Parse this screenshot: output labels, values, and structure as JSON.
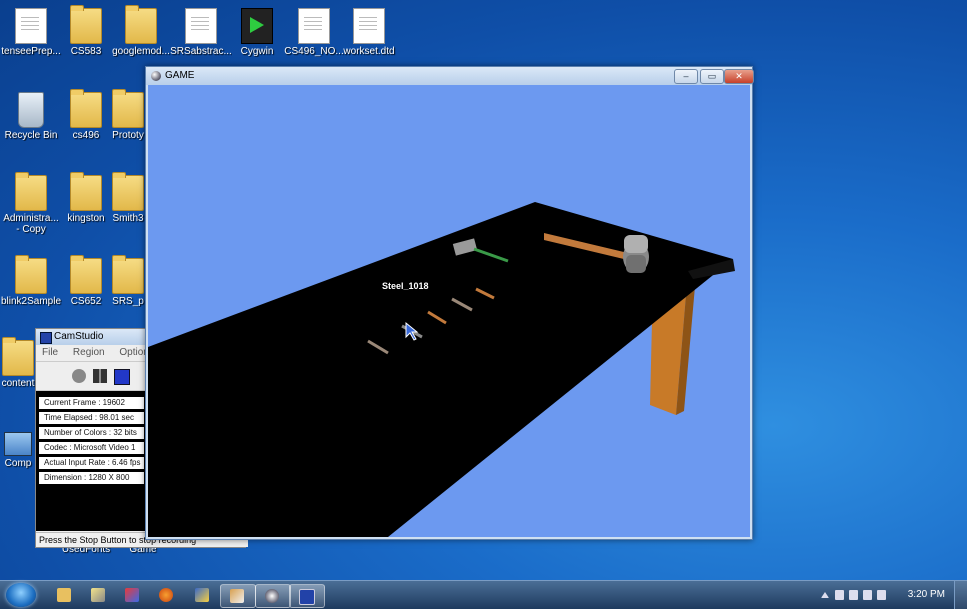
{
  "desktop": {
    "icons": [
      {
        "label": "tenseePrep...",
        "icon": "document-icon"
      },
      {
        "label": "CS583",
        "icon": "folder-icon"
      },
      {
        "label": "googlemod...",
        "icon": "folder-icon"
      },
      {
        "label": "SRSabstrac...",
        "icon": "document-icon"
      },
      {
        "label": "Cygwin",
        "icon": "cygwin-icon"
      },
      {
        "label": "CS496_NO...",
        "icon": "document-icon"
      },
      {
        "label": "workset.dtd",
        "icon": "document-icon"
      },
      {
        "label": "Recycle Bin",
        "icon": "recycle-bin-icon"
      },
      {
        "label": "cs496",
        "icon": "folder-icon"
      },
      {
        "label": "Prototy",
        "icon": "folder-icon"
      },
      {
        "label": "Administra...",
        "label2": "- Copy",
        "icon": "folder-icon"
      },
      {
        "label": "kingston",
        "icon": "folder-icon"
      },
      {
        "label": "Smith3",
        "icon": "folder-icon"
      },
      {
        "label": "blink2Sample",
        "icon": "folder-icon"
      },
      {
        "label": "CS652",
        "icon": "folder-icon"
      },
      {
        "label": "SRS_p",
        "icon": "folder-icon"
      },
      {
        "label": "content",
        "icon": "folder-icon"
      },
      {
        "label": "Comp",
        "icon": "computer-icon"
      },
      {
        "label": "UsedFonts",
        "icon": "folder-icon"
      },
      {
        "label": "Game",
        "icon": "folder-icon"
      }
    ]
  },
  "game_window": {
    "title": "GAME",
    "buttons": {
      "minimize": "–",
      "maximize": "▭",
      "close": "✕"
    },
    "scene": {
      "object_label": "Steel_1018",
      "background_color": "#6c99f0",
      "table_color": "#000000",
      "table_leg_color": "#c87a28"
    }
  },
  "camstudio": {
    "title": "CamStudio",
    "menu": [
      "File",
      "Region",
      "Options"
    ],
    "stats": [
      "Current Frame : 19602",
      "Time Elapsed : 98.01 sec",
      "Number of Colors : 32 bits",
      "Codec : Microsoft Video 1",
      "Actual Input Rate : 6.46 fps",
      "Dimension : 1280 X 800"
    ],
    "status": "Press the Stop Button to stop recording"
  },
  "taskbar": {
    "clock": "3:20 PM",
    "items": [
      "explorer-icon",
      "notepad-icon",
      "paint-icon",
      "firefox-icon",
      "python-icon",
      "tool-icon",
      "game-icon",
      "camstudio-icon"
    ]
  }
}
